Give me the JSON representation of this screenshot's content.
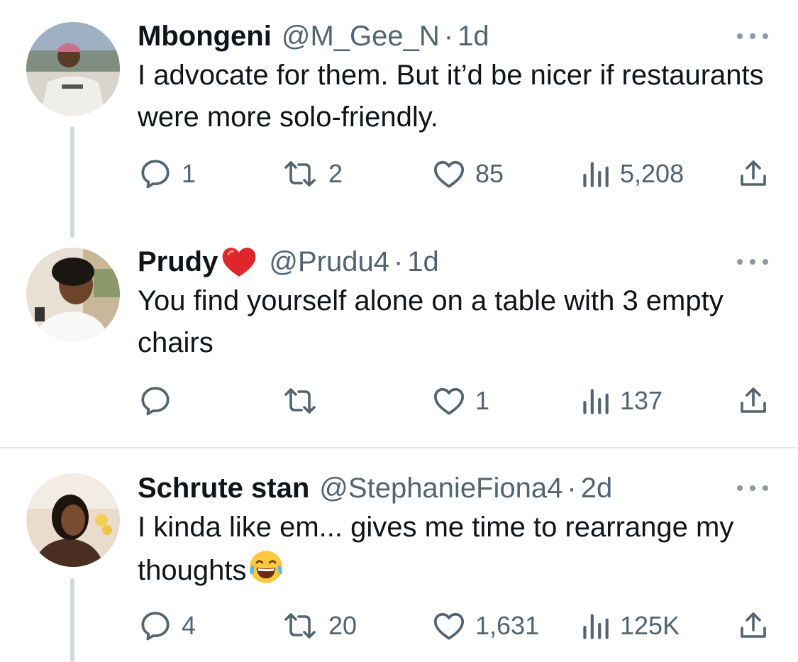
{
  "tweets": [
    {
      "display_name": "Mbongeni",
      "handle": "@M_Gee_N",
      "separator": "·",
      "time": "1d",
      "text": "I advocate for them. But it’d be nicer if restaurants were more solo-friendly.",
      "replies": "1",
      "retweets": "2",
      "likes": "85",
      "views": "5,208"
    },
    {
      "display_name": "Prudy",
      "handle": "@Prudu4",
      "separator": "·",
      "time": "1d",
      "text": "You find yourself alone on a table with 3 empty chairs",
      "replies": "",
      "retweets": "",
      "likes": "1",
      "views": "137"
    },
    {
      "display_name": "Schrute stan",
      "handle": "@StephanieFiona4",
      "separator": "·",
      "time": "2d",
      "text": "I kinda like em... gives me time to rearrange my thoughts",
      "replies": "4",
      "retweets": "20",
      "likes": "1,631",
      "views": "125K"
    }
  ],
  "colors": {
    "text_primary": "#0f1419",
    "text_secondary": "#536471",
    "thread_line": "#cfd9de",
    "divider": "#e7e9ea"
  },
  "icons": {
    "reply": "reply-icon",
    "retweet": "retweet-icon",
    "like": "heart-icon",
    "views": "views-icon",
    "share": "share-icon",
    "more": "more-icon"
  }
}
